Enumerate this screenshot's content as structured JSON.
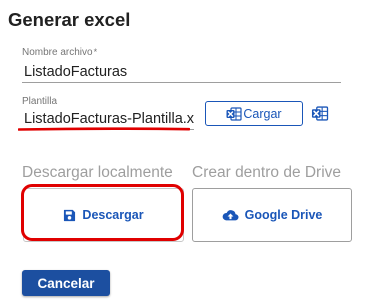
{
  "dialog": {
    "title": "Generar excel"
  },
  "fields": {
    "file_name": {
      "label": "Nombre archivo",
      "required_mark": "*",
      "value": "ListadoFacturas"
    },
    "template": {
      "label": "Plantilla",
      "value": "ListadoFacturas-Plantilla.xlsx"
    }
  },
  "buttons": {
    "load_label": "Cargar",
    "download_label": "Descargar",
    "drive_label": "Google Drive",
    "cancel_label": "Cancelar"
  },
  "sections": {
    "local_heading": "Descargar localmente",
    "drive_heading": "Crear dentro de Drive"
  },
  "icons": {
    "load": "excel-icon",
    "template_preview": "excel-icon",
    "download": "save-icon",
    "drive": "cloud-upload-icon"
  },
  "colors": {
    "accent_blue": "#1a56b8",
    "cancel_bg": "#1c4fa0",
    "highlight_red": "#e00000"
  }
}
